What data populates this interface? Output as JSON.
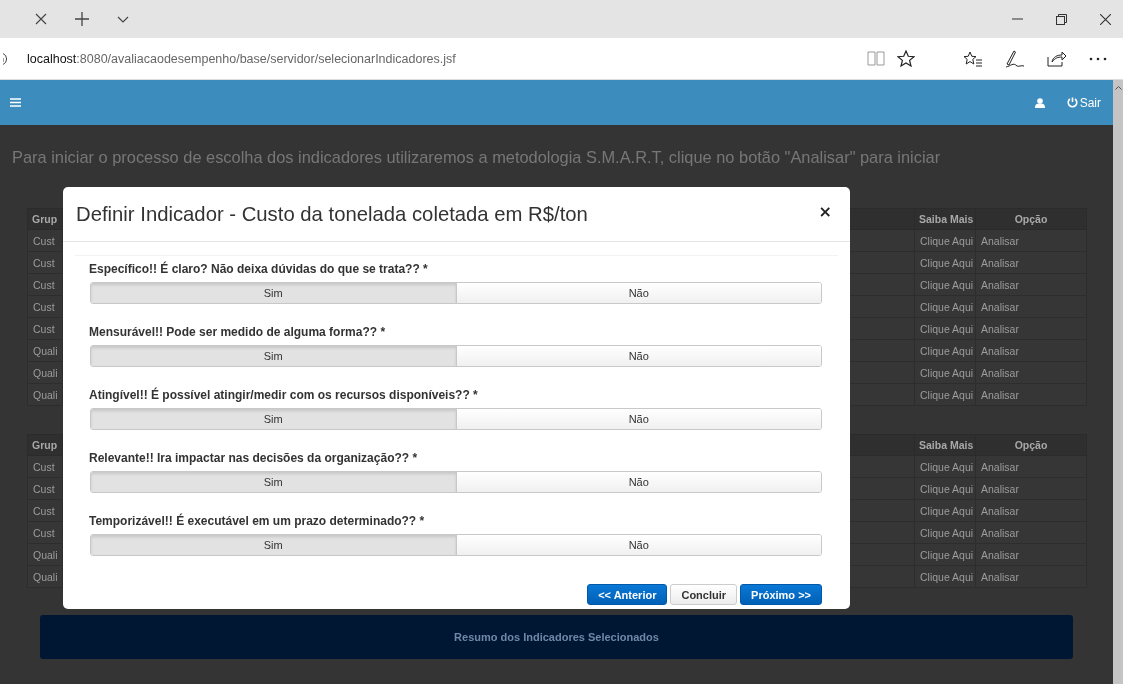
{
  "address_bar": {
    "host": "localhost",
    "path": ":8080/avaliacaodesempenho/base/servidor/selecionarIndicadores.jsf"
  },
  "app_header": {
    "logout_label": "Sair"
  },
  "intro": "Para iniciar o processo de escolha dos indicadores utilizaremos a metodologia S.M.A.R.T, clique no botão \"Analisar\" para iniciar",
  "tables": [
    {
      "columns": [
        "Grup",
        "Saiba Mais",
        "Opção"
      ],
      "rows": [
        [
          "Cust",
          "Clique Aqui",
          "Analisar"
        ],
        [
          "Cust",
          "Clique Aqui",
          "Analisar"
        ],
        [
          "Cust",
          "Clique Aqui",
          "Analisar"
        ],
        [
          "Cust",
          "Clique Aqui",
          "Analisar"
        ],
        [
          "Cust",
          "Clique Aqui",
          "Analisar"
        ],
        [
          "Quali",
          "Clique Aqui",
          "Analisar"
        ],
        [
          "Quali",
          "Clique Aqui",
          "Analisar"
        ],
        [
          "Quali",
          "Clique Aqui",
          "Analisar"
        ]
      ]
    },
    {
      "columns": [
        "Grup",
        "Saiba Mais",
        "Opção"
      ],
      "rows": [
        [
          "Cust",
          "Clique Aqui",
          "Analisar"
        ],
        [
          "Cust",
          "Clique Aqui",
          "Analisar"
        ],
        [
          "Cust",
          "Clique Aqui",
          "Analisar"
        ],
        [
          "Cust",
          "Clique Aqui",
          "Analisar"
        ],
        [
          "Quali",
          "Clique Aqui",
          "Analisar"
        ],
        [
          "Quali",
          "Clique Aqui",
          "Analisar"
        ]
      ]
    }
  ],
  "summary_button": "Resumo dos Indicadores Selecionados",
  "dialog": {
    "title": "Definir Indicador - Custo da tonelada coletada em R$/ton",
    "close": "×",
    "questions": [
      {
        "label": "Específico!! É claro? Não deixa dúvidas do que se trata?? *",
        "options": [
          {
            "label": "Sim",
            "selected": true
          },
          {
            "label": "Não",
            "selected": false
          }
        ]
      },
      {
        "label": "Mensurável!! Pode ser medido de alguma forma?? *",
        "options": [
          {
            "label": "Sim",
            "selected": true
          },
          {
            "label": "Não",
            "selected": false
          }
        ]
      },
      {
        "label": "Atingível!! É possível atingir/medir com os recursos disponíveis?? *",
        "options": [
          {
            "label": "Sim",
            "selected": true
          },
          {
            "label": "Não",
            "selected": false
          }
        ]
      },
      {
        "label": "Relevante!! Ira impactar nas decisões da organização?? *",
        "options": [
          {
            "label": "Sim",
            "selected": true
          },
          {
            "label": "Não",
            "selected": false
          }
        ]
      },
      {
        "label": "Temporizável!! É executável em um prazo determinado?? *",
        "options": [
          {
            "label": "Sim",
            "selected": true
          },
          {
            "label": "Não",
            "selected": false
          }
        ]
      }
    ],
    "buttons": [
      {
        "label": "<< Anterior",
        "kind": "primary"
      },
      {
        "label": "Concluir",
        "kind": "default"
      },
      {
        "label": "Próximo >>",
        "kind": "primary"
      }
    ]
  }
}
